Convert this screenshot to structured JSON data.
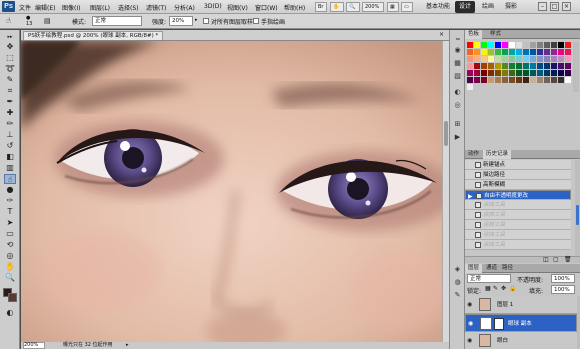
{
  "app": {
    "logo": "Ps",
    "zoom": "200%"
  },
  "menu": {
    "items": [
      "文件",
      "编辑(E)",
      "图像(I)",
      "图层(L)",
      "选择(S)",
      "滤镜(T)",
      "分析(A)",
      "3D(D)",
      "视图(V)",
      "窗口(W)",
      "帮助(H)"
    ]
  },
  "workspace": {
    "buttons": [
      "基本功能",
      "设计",
      "绘画",
      "摄影"
    ],
    "active": "设计"
  },
  "options": {
    "brush_size": "13",
    "mode_label": "模式:",
    "mode_value": "正常",
    "strength_label": "强度:",
    "strength_value": "20%",
    "sample_all_label": "对所有图层取样",
    "finger_label": "手指绘画"
  },
  "document": {
    "tab_title": "PS妖手绘教程.psd @ 200% (眼球 副本, RGB/8#) *",
    "zoom": "200%",
    "status": "曝光只在 32 位起作用"
  },
  "swatches": {
    "tabs": [
      "色板",
      "样式"
    ],
    "colors": [
      "#ff0000",
      "#ffff00",
      "#00ff00",
      "#00ffff",
      "#0000ff",
      "#ff00ff",
      "#ffffff",
      "#e0e0e0",
      "#c0c0c0",
      "#a0a0a0",
      "#808080",
      "#606060",
      "#404040",
      "#000000",
      "#ed1c24",
      "#f26522",
      "#f7941d",
      "#fff200",
      "#8dc63f",
      "#39b54a",
      "#00a651",
      "#00a99d",
      "#00aeef",
      "#0072bc",
      "#0054a6",
      "#2e3192",
      "#662d91",
      "#92278f",
      "#ec008c",
      "#ed145b",
      "#f69679",
      "#f9ad81",
      "#fdc689",
      "#fff79a",
      "#c4df9b",
      "#a3d39c",
      "#82ca9d",
      "#7accc8",
      "#6dcff6",
      "#7da7d9",
      "#8393ca",
      "#8781bd",
      "#a187be",
      "#bc8dbf",
      "#f49ac2",
      "#f6989d",
      "#9e0b0f",
      "#a0410d",
      "#a36209",
      "#aba000",
      "#598527",
      "#1a7b30",
      "#007236",
      "#00746b",
      "#0076a3",
      "#004a80",
      "#003471",
      "#1b1464",
      "#440e62",
      "#630460",
      "#9e005d",
      "#9e0039",
      "#790000",
      "#7b2e00",
      "#7d4900",
      "#827b00",
      "#406618",
      "#005e20",
      "#005826",
      "#005952",
      "#005b7f",
      "#003663",
      "#002157",
      "#0d004c",
      "#32004b",
      "#4b0049",
      "#7b0046",
      "#7a0026",
      "#c69c6d",
      "#a67c52",
      "#8c6239",
      "#754c24",
      "#603913",
      "#3c2415",
      "#c7b299",
      "#998675",
      "#736357",
      "#534741",
      "#362f2d",
      "#ffffff",
      "#eeeeee"
    ]
  },
  "history": {
    "tabs": [
      "动作",
      "历史记录"
    ],
    "items": [
      {
        "label": "新建锚点",
        "state": "normal"
      },
      {
        "label": "描边路径",
        "state": "normal"
      },
      {
        "label": "高斯模糊",
        "state": "normal"
      },
      {
        "label": "自由不透明度更改",
        "state": "selected"
      },
      {
        "label": "涂抹工具",
        "state": "dim"
      },
      {
        "label": "涂抹工具",
        "state": "dim"
      },
      {
        "label": "涂抹工具",
        "state": "dim"
      },
      {
        "label": "涂抹工具",
        "state": "dim"
      },
      {
        "label": "涂抹工具",
        "state": "dim"
      }
    ]
  },
  "layers": {
    "tabs": [
      "图层",
      "通道",
      "路径"
    ],
    "blend_mode": "正常",
    "opacity_label": "不透明度:",
    "opacity_value": "100%",
    "lock_label": "锁定:",
    "fill_label": "填充:",
    "fill_value": "100%",
    "items": [
      {
        "name": "图层 1",
        "selected": false
      },
      {
        "name": "眼球 副本",
        "selected": true
      },
      {
        "name": "眼白",
        "selected": false
      }
    ]
  }
}
